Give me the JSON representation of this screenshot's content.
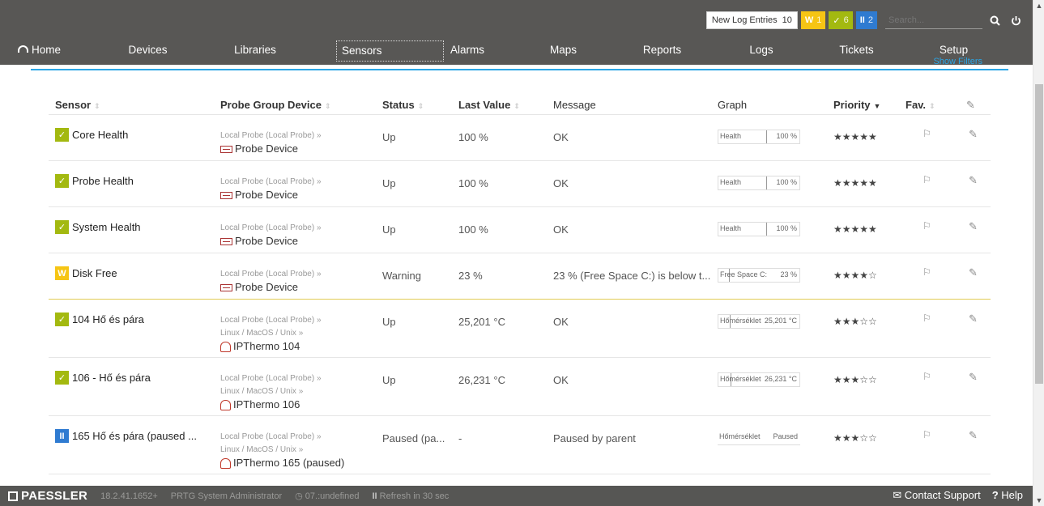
{
  "topbar": {
    "new_log_label": "New Log Entries",
    "new_log_count": "10",
    "warning_badge": "W",
    "warning_count": "1",
    "up_badge": "✓",
    "up_count": "6",
    "paused_badge": "II",
    "paused_count": "2",
    "search_placeholder": "Search..."
  },
  "nav": [
    "Home",
    "Devices",
    "Libraries",
    "Sensors",
    "Alarms",
    "Maps",
    "Reports",
    "Logs",
    "Tickets",
    "Setup"
  ],
  "hint_link": "Show Filters",
  "columns": {
    "sensor": "Sensor",
    "probe": "Probe Group Device",
    "status": "Status",
    "last_value": "Last Value",
    "message": "Message",
    "graph": "Graph",
    "priority": "Priority",
    "fav": "Fav."
  },
  "rows": [
    {
      "status_type": "up",
      "name": "Core Health",
      "probe_lines": [
        "Local Probe (Local Probe) »"
      ],
      "device": "Probe Device",
      "device_icon": "probe-device-icon",
      "status": "Up",
      "last_value": "100 %",
      "message": "OK",
      "graph_label": "Health",
      "graph_value": "100 %",
      "graph_fill": 1.0,
      "priority": 5
    },
    {
      "status_type": "up",
      "name": "Probe Health",
      "probe_lines": [
        "Local Probe (Local Probe) »"
      ],
      "device": "Probe Device",
      "device_icon": "probe-device-icon",
      "status": "Up",
      "last_value": "100 %",
      "message": "OK",
      "graph_label": "Health",
      "graph_value": "100 %",
      "graph_fill": 1.0,
      "priority": 5
    },
    {
      "status_type": "up",
      "name": "System Health",
      "probe_lines": [
        "Local Probe (Local Probe) »"
      ],
      "device": "Probe Device",
      "device_icon": "probe-device-icon",
      "status": "Up",
      "last_value": "100 %",
      "message": "OK",
      "graph_label": "Health",
      "graph_value": "100 %",
      "graph_fill": 1.0,
      "priority": 5
    },
    {
      "status_type": "warn",
      "name": "Disk Free",
      "probe_lines": [
        "Local Probe (Local Probe) »"
      ],
      "device": "Probe Device",
      "device_icon": "probe-device-icon",
      "status": "Warning",
      "last_value": "23 %",
      "message": "23 % (Free Space C:) is below t...",
      "graph_label": "Free Space C:",
      "graph_value": "23 %",
      "graph_fill": 0.23,
      "priority": 4
    },
    {
      "status_type": "up",
      "name": "104 Hő és pára",
      "probe_lines": [
        "Local Probe (Local Probe) »",
        "Linux / MacOS / Unix »"
      ],
      "device": "IPThermo 104",
      "device_icon": "ipthermo-icon",
      "status": "Up",
      "last_value": "25,201 °C",
      "message": "OK",
      "graph_label": "Hőmérséklet",
      "graph_value": "25,201 °C",
      "graph_fill": 0.25,
      "priority": 3
    },
    {
      "status_type": "up",
      "name": "106 - Hő és pára",
      "probe_lines": [
        "Local Probe (Local Probe) »",
        "Linux / MacOS / Unix »"
      ],
      "device": "IPThermo 106",
      "device_icon": "ipthermo-icon",
      "status": "Up",
      "last_value": "26,231 °C",
      "message": "OK",
      "graph_label": "Hőmérséklet",
      "graph_value": "26,231 °C",
      "graph_fill": 0.26,
      "priority": 3
    },
    {
      "status_type": "pause",
      "name": "165 Hő és pára (paused ...",
      "probe_lines": [
        "Local Probe (Local Probe) »",
        "Linux / MacOS / Unix »"
      ],
      "device": "IPThermo 165 (paused)",
      "device_icon": "ipthermo-icon",
      "status": "Paused (pa...",
      "last_value": "-",
      "message": "Paused by parent",
      "graph_label": "Hőmérséklet",
      "graph_value": "Paused",
      "graph_fill": 0,
      "priority": 3
    }
  ],
  "bottombar": {
    "brand": "PAESSLER",
    "version": "18.2.41.1652+",
    "user": "PRTG System Administrator",
    "clock": "07.:undefined",
    "refresh": "Refresh in 30 sec",
    "contact": "Contact Support",
    "help": "Help"
  },
  "colors": {
    "up": "#a3b910",
    "warning": "#f6c514",
    "paused": "#2f7bd1",
    "topbar": "#585755",
    "accent": "#2aa6e6"
  }
}
